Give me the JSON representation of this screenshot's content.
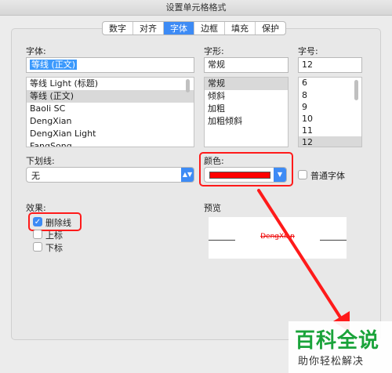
{
  "window": {
    "title": "设置单元格格式"
  },
  "tabs": [
    "数字",
    "对齐",
    "字体",
    "边框",
    "填充",
    "保护"
  ],
  "font": {
    "label": "字体:",
    "value": "等线 (正文)",
    "items": [
      "等线 Light (标题)",
      "等线 (正文)",
      "Baoli SC",
      "DengXian",
      "DengXian Light",
      "FangSong"
    ]
  },
  "style": {
    "label": "字形:",
    "value": "常规",
    "items": [
      "常规",
      "倾斜",
      "加粗",
      "加粗倾斜"
    ]
  },
  "size": {
    "label": "字号:",
    "value": "12",
    "items": [
      "6",
      "8",
      "9",
      "10",
      "11",
      "12"
    ]
  },
  "underline": {
    "label": "下划线:",
    "value": "无"
  },
  "color": {
    "label": "颜色:",
    "swatch": "#ff0000",
    "normal_font_label": "普通字体"
  },
  "effects": {
    "label": "效果:",
    "strikethrough": "删除线",
    "superscript": "上标",
    "subscript": "下标"
  },
  "preview": {
    "label": "预览",
    "sample": "DengXian"
  },
  "watermark": {
    "brand": "百科全说",
    "slogan": "助你轻松解决"
  },
  "colors": {
    "accent": "#3d8bf5",
    "highlight": "#ff1a1a",
    "brand_green": "#1aa33a"
  }
}
